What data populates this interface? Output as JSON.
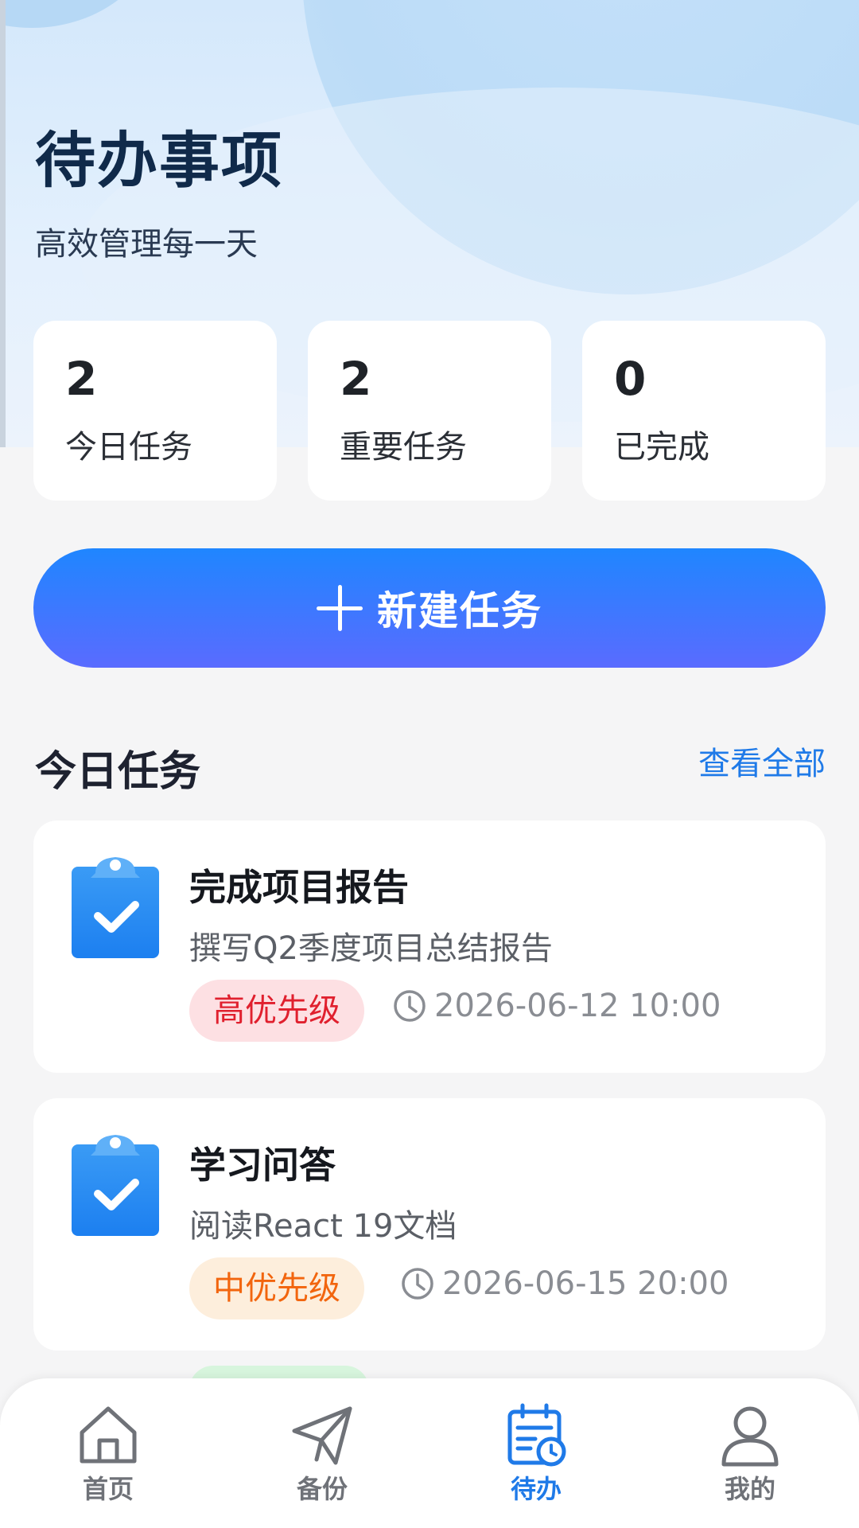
{
  "header": {
    "title": "待办事项",
    "subtitle": "高效管理每一天"
  },
  "stats": [
    {
      "value": "2",
      "label": "今日任务"
    },
    {
      "value": "2",
      "label": "重要任务"
    },
    {
      "value": "0",
      "label": "已完成"
    }
  ],
  "actions": {
    "new_task": "新建任务"
  },
  "section": {
    "title": "今日任务",
    "view_all": "查看全部"
  },
  "tasks": [
    {
      "title": "完成项目报告",
      "desc": "撰写Q2季度项目总结报告",
      "priority": "高优先级",
      "due": "2026-06-12 10:00",
      "priority_color": "#e0202e"
    },
    {
      "title": "学习问答",
      "desc": "阅读React 19文档",
      "priority": "中优先级",
      "due": "2026-06-15 20:00",
      "priority_color": "#f2650e"
    }
  ],
  "tabbar": {
    "items": [
      {
        "label": "首页",
        "icon": "home-icon"
      },
      {
        "label": "备份",
        "icon": "paper-plane-icon"
      },
      {
        "label": "待办",
        "icon": "calendar-clock-icon",
        "active": true
      },
      {
        "label": "我的",
        "icon": "user-icon"
      }
    ],
    "active_color": "#1f7ae8"
  },
  "colors": {
    "accent": "#1f7ae8",
    "button_gradient_start": "#1f86ff",
    "button_gradient_end": "#5a6bff"
  }
}
